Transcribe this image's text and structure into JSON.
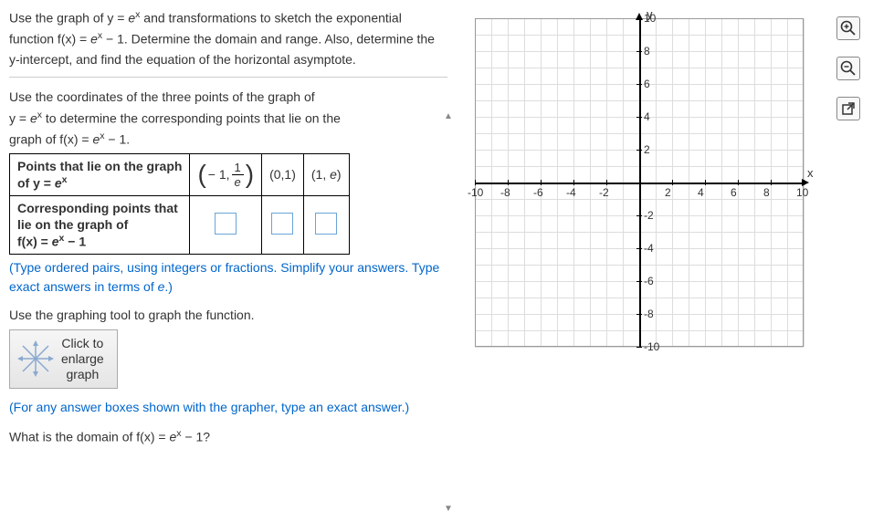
{
  "problem": {
    "intro": "Use the graph of y = e ˣ and transformations to sketch the exponential function f(x) = e ˣ − 1. Determine the domain and range. Also, determine the y-intercept, and find the equation of the horizontal asymptote."
  },
  "instruction": {
    "line1": "Use the coordinates of the three points of the graph of",
    "line2": "y = e ˣ to determine the corresponding points that lie on the",
    "line3": "graph of f(x) = e ˣ − 1."
  },
  "table": {
    "row1_header": "Points that lie on the graph of y = e ˣ",
    "row2_header": "Corresponding points that lie on the graph of f(x) = e ˣ − 1",
    "point1_prefix": "− 1,",
    "point1_num": "1",
    "point1_den": "e",
    "point2": "(0,1)",
    "point3": "(1, e)"
  },
  "hints": {
    "pairs": "(Type ordered pairs, using integers or fractions. Simplify your answers. Type exact answers in terms of e.)",
    "grapher": "(For any answer boxes shown with the grapher, type an exact answer.)"
  },
  "graph_tool": {
    "prompt": "Use the graphing tool to graph the function.",
    "button_line1": "Click to",
    "button_line2": "enlarge",
    "button_line3": "graph"
  },
  "domain_question": "What is the domain of f(x) = e ˣ − 1?",
  "axis": {
    "y_label": "y",
    "x_label": "x"
  },
  "chart_data": {
    "type": "scatter",
    "title": "",
    "xlabel": "x",
    "ylabel": "y",
    "xlim": [
      -10,
      10
    ],
    "ylim": [
      -10,
      10
    ],
    "x_ticks": [
      -10,
      -8,
      -6,
      -4,
      -2,
      2,
      4,
      6,
      8,
      10
    ],
    "y_ticks": [
      -10,
      -8,
      -6,
      -4,
      -2,
      2,
      4,
      6,
      8,
      10
    ],
    "grid": true,
    "series": []
  }
}
